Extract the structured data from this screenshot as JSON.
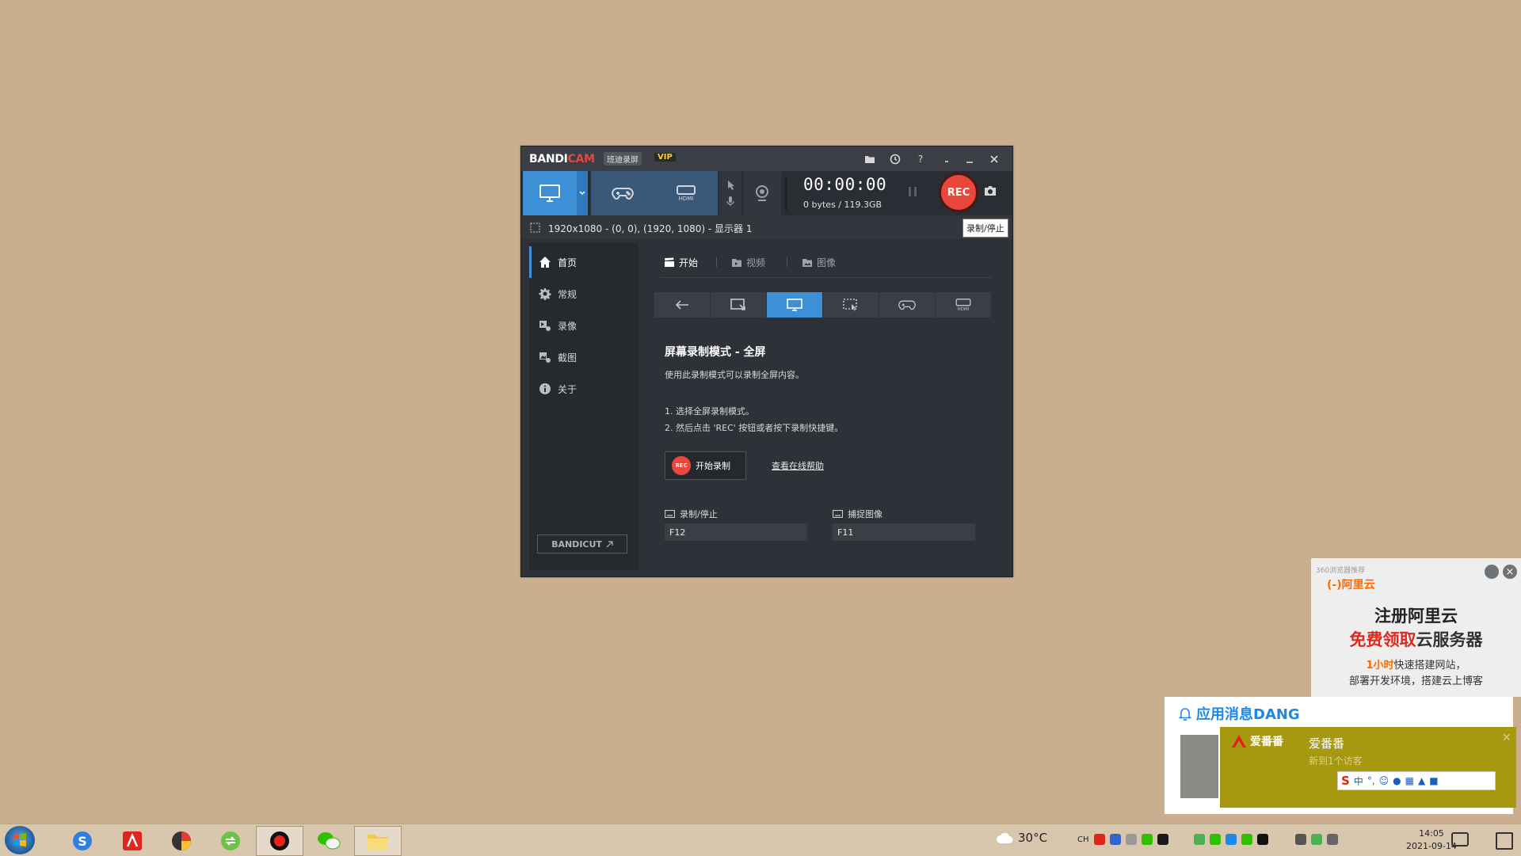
{
  "bandicam": {
    "logo_bandi": "BANDI",
    "logo_cam": "CAM",
    "logo_cn": "班迪录屏",
    "vip": "VIP",
    "timer": "00:00:00",
    "file_size": "0 bytes / 119.3GB",
    "rec_label": "REC",
    "area_text": "1920x1080 - (0, 0), (1920, 1080) - 显示器 1",
    "tooltip": "录制/停止",
    "sidebar": {
      "items": [
        {
          "label": "首页",
          "icon": "home-icon"
        },
        {
          "label": "常规",
          "icon": "gear-icon"
        },
        {
          "label": "录像",
          "icon": "video-settings-icon"
        },
        {
          "label": "截图",
          "icon": "image-settings-icon"
        },
        {
          "label": "关于",
          "icon": "info-icon"
        }
      ],
      "bandicut": "BANDICUT"
    },
    "content_tabs": [
      {
        "label": "开始",
        "icon": "clapper-icon"
      },
      {
        "label": "视频",
        "icon": "video-folder-icon"
      },
      {
        "label": "图像",
        "icon": "image-folder-icon"
      }
    ],
    "mode_title": "屏幕录制模式 - 全屏",
    "mode_desc": "使用此录制模式可以录制全屏内容。",
    "step1": "1. 选择全屏录制模式。",
    "step2": "2. 然后点击 'REC' 按钮或者按下录制快捷键。",
    "start_rec_label": "开始录制",
    "start_rec_dot": "REC",
    "help_link": "查看在线帮助",
    "hotkey_record_label": "录制/停止",
    "hotkey_record_value": "F12",
    "hotkey_capture_label": "捕捉图像",
    "hotkey_capture_value": "F11",
    "accent": "#3d8fd6",
    "rec_color": "#e8473c"
  },
  "ad": {
    "small_text": "360浏览器推荐",
    "brand": "(-)阿里云",
    "line1": "注册阿里云",
    "line2_red": "免费领取",
    "line2_rest": "云服务器",
    "line3_orange": "1小时",
    "line3_rest": "快速搭建网站，",
    "line4": "部署开发环境，搭建云上博客"
  },
  "notification": {
    "header": "应用消息DANG",
    "app_name": "爱番番",
    "title": "爱番番",
    "subtitle": "新到1个访客",
    "ime_s": "S",
    "ime_mode": "中"
  },
  "taskbar": {
    "weather": "30°C",
    "time": "14:05",
    "date": "2021-09-14",
    "tray_label": "CH"
  }
}
